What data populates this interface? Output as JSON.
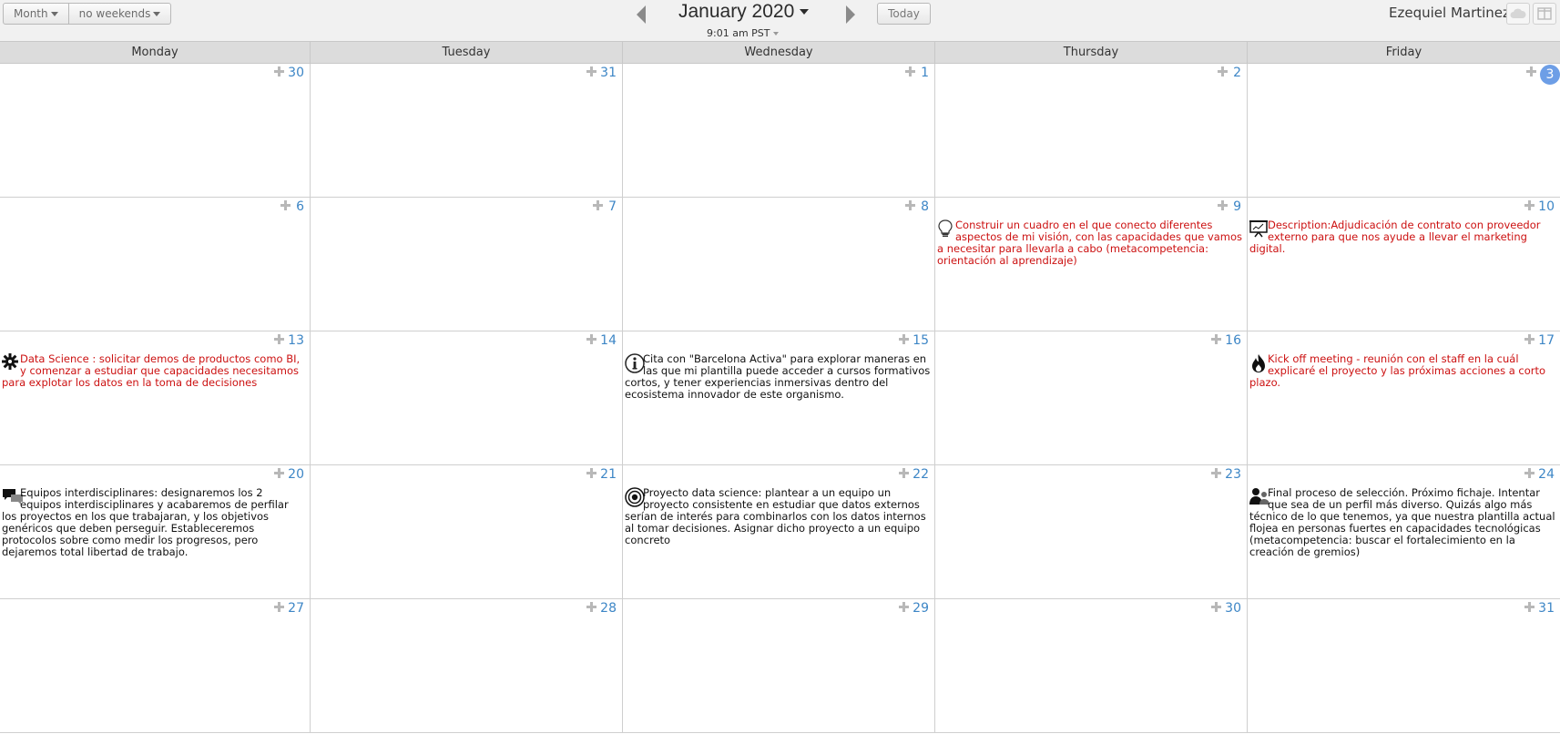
{
  "toolbar": {
    "view_label": "Month",
    "weekends_label": "no weekends",
    "month_title": "January 2020",
    "time_label": "9:01 am PST",
    "today_label": "Today",
    "user_name": "Ezequiel Martinez"
  },
  "calendar": {
    "day_headers": [
      "Monday",
      "Tuesday",
      "Wednesday",
      "Thursday",
      "Friday"
    ],
    "today": "3",
    "weeks": [
      {
        "days": [
          {
            "num": "30"
          },
          {
            "num": "31"
          },
          {
            "num": "1"
          },
          {
            "num": "2"
          },
          {
            "num": "3"
          }
        ]
      },
      {
        "days": [
          {
            "num": "6"
          },
          {
            "num": "7"
          },
          {
            "num": "8"
          },
          {
            "num": "9",
            "event": {
              "icon": "lightbulb-icon",
              "color": "#cc1111",
              "text": "Construir un cuadro en el que conecto diferentes aspectos de mi visión, con las capacidades que vamos a necesitar para llevarla a cabo (metacompetencia: orientación al aprendizaje)"
            }
          },
          {
            "num": "10",
            "event": {
              "icon": "presentation-icon",
              "color": "#cc1111",
              "text": "Description:Adjudicación de contrato con proveedor externo para que nos ayude a llevar el marketing digital."
            }
          }
        ]
      },
      {
        "days": [
          {
            "num": "13",
            "event": {
              "icon": "gear-icon",
              "color": "#cc1111",
              "text": "Data Science : solicitar demos de productos como BI, y comenzar a estudiar que capacidades necesitamos para explotar los datos en la toma de decisiones"
            }
          },
          {
            "num": "14"
          },
          {
            "num": "15",
            "event": {
              "icon": "info-icon",
              "color": "#111111",
              "text": "Cita con \"Barcelona Activa\" para explorar maneras en las que mi plantilla puede acceder a cursos formativos cortos, y tener experiencias inmersivas dentro del ecosistema innovador de este organismo."
            }
          },
          {
            "num": "16"
          },
          {
            "num": "17",
            "event": {
              "icon": "fire-icon",
              "color": "#cc1111",
              "text": "Kick off meeting - reunión con el staff en la cuál explicaré el proyecto y las próximas acciones a corto plazo."
            }
          }
        ]
      },
      {
        "days": [
          {
            "num": "20",
            "event": {
              "icon": "chat-icon",
              "color": "#111111",
              "text": "Equipos interdisciplinares: designaremos los 2 equipos interdisciplinares y acabaremos de perfilar los proyectos en los que trabajaran, y los objetivos genéricos que deben perseguir. Estableceremos protocolos sobre como medir los progresos, pero dejaremos total libertad de trabajo."
            }
          },
          {
            "num": "21"
          },
          {
            "num": "22",
            "event": {
              "icon": "target-icon",
              "color": "#111111",
              "text": "Proyecto data science: plantear a un equipo un proyecto consistente en estudiar que datos externos serían de interés para combinarlos con los datos internos al tomar decisiones. Asignar dicho proyecto a un equipo concreto"
            }
          },
          {
            "num": "23"
          },
          {
            "num": "24",
            "event": {
              "icon": "users-icon",
              "color": "#111111",
              "text": "Final proceso de selección. Próximo fichaje. Intentar que sea de un perfil más diverso. Quizás algo más técnico de lo que tenemos, ya que nuestra plantilla actual flojea en personas fuertes en capacidades tecnológicas (metacompetencia: buscar el fortalecimiento en la creación de gremios)"
            }
          }
        ]
      },
      {
        "days": [
          {
            "num": "27"
          },
          {
            "num": "28"
          },
          {
            "num": "29"
          },
          {
            "num": "30"
          },
          {
            "num": "31"
          }
        ]
      }
    ]
  }
}
